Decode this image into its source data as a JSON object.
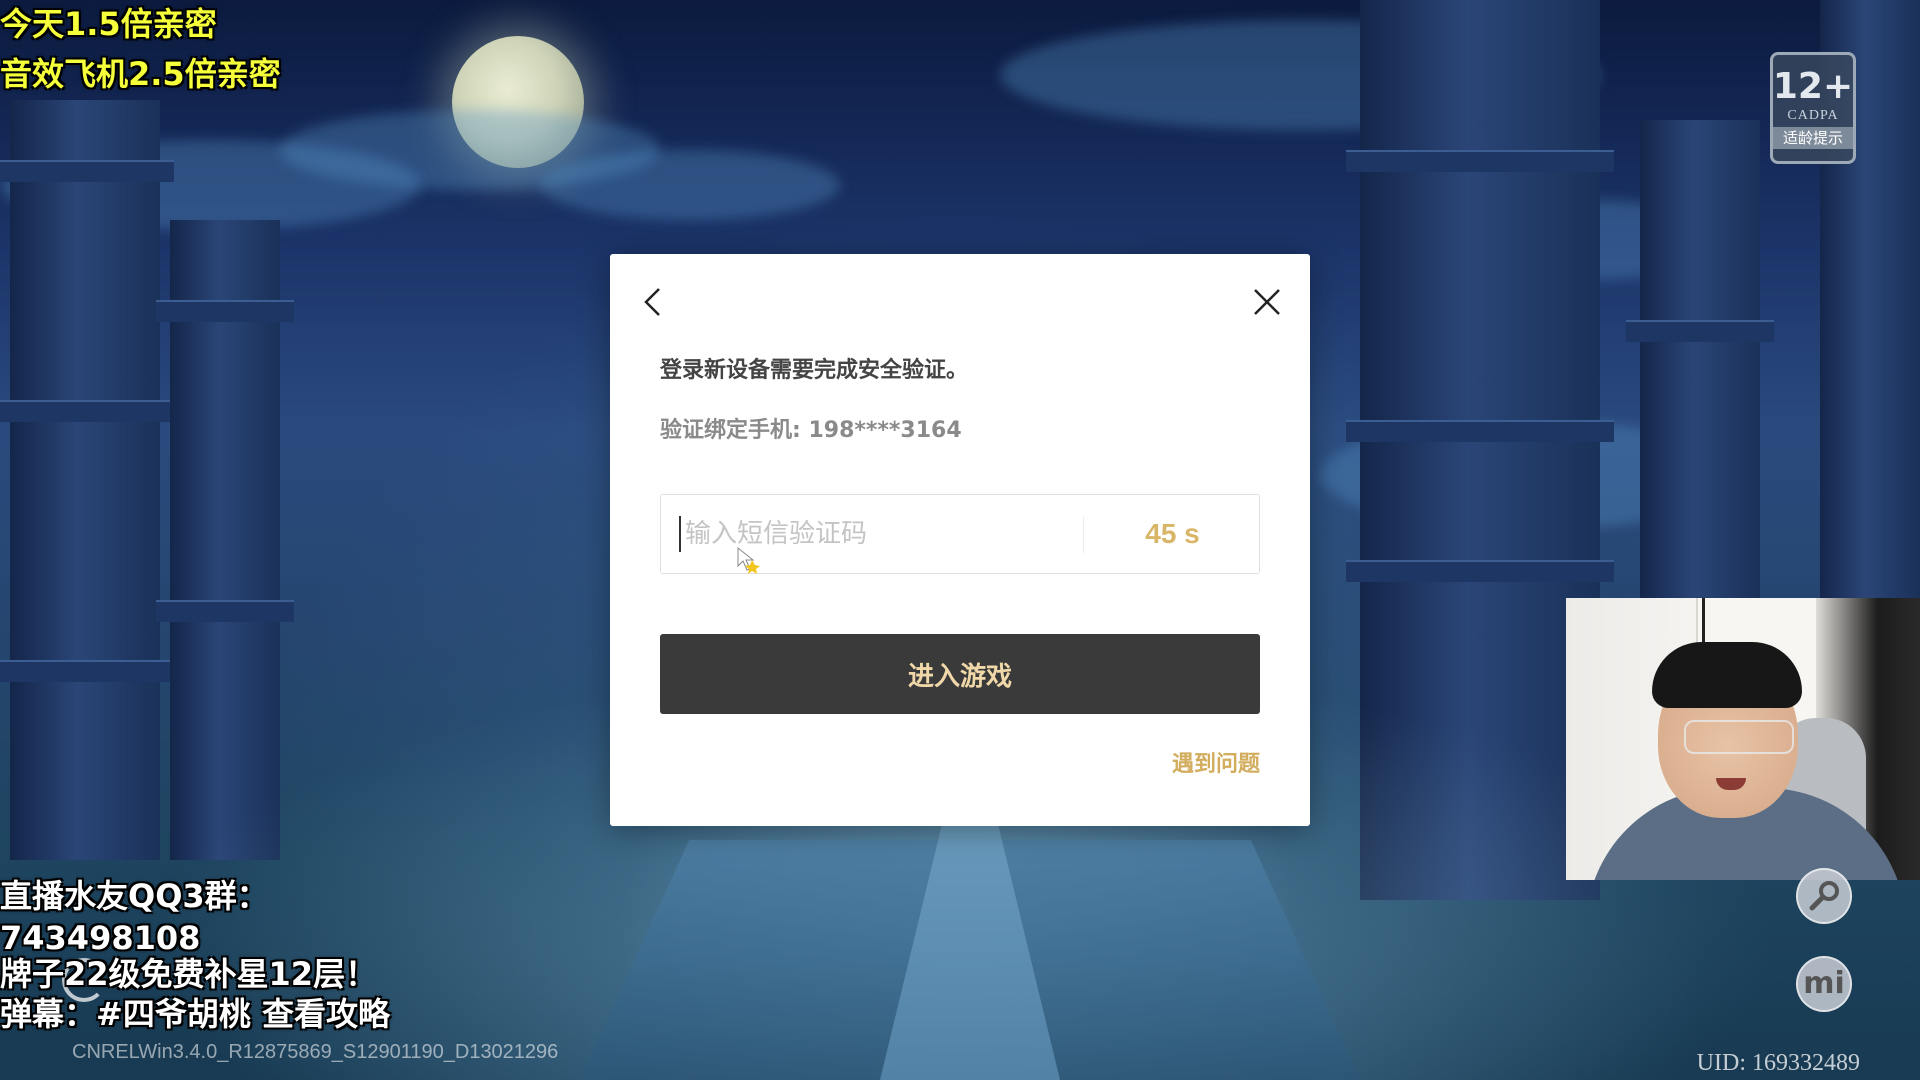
{
  "overlay": {
    "promo_line1": "今天1.5倍亲密",
    "promo_line2": "音效飞机2.5倍亲密",
    "qq_group_label": "直播水友QQ3群：",
    "qq_group_number": "743498108",
    "badge_offer": "牌子22级免费补星12层！",
    "danmaku_tip": "弹幕：#四爷胡桃 查看攻略",
    "build_info": "CNRELWin3.4.0_R12875869_S12901190_D13021296",
    "uid": "UID: 169332489"
  },
  "age_badge": {
    "age": "12+",
    "org": "CADPA",
    "tip": "适龄提示"
  },
  "modal": {
    "message": "登录新设备需要完成安全验证。",
    "phone_label": "验证绑定手机: 198****3164",
    "code_input": {
      "value": "",
      "placeholder": "输入短信验证码"
    },
    "countdown": "45 s",
    "enter_button": "进入游戏",
    "help_link": "遇到问题",
    "icons": {
      "back": "chevron-left-icon",
      "close": "close-icon"
    }
  },
  "tools": {
    "mi_label": "mi"
  },
  "colors": {
    "promo_yellow": "#f5ff3a",
    "countdown_gold": "#d9b567",
    "help_gold": "#d2ad5e",
    "enter_button_bg": "#3a3a3a",
    "enter_button_text": "#f0d8a8"
  }
}
